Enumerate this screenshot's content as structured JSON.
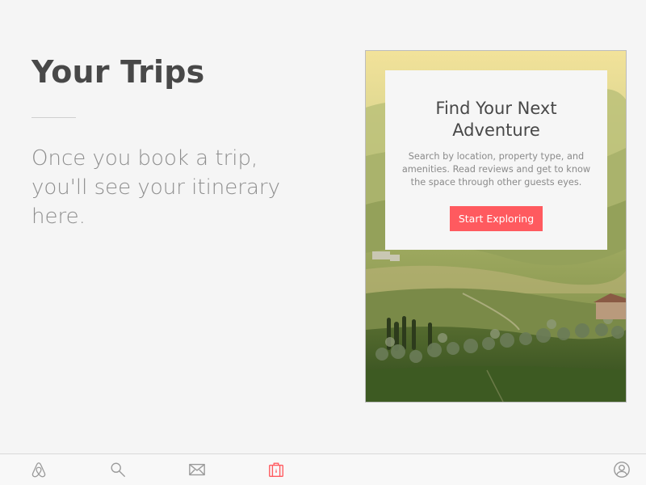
{
  "page": {
    "title": "Your Trips",
    "empty_message": "Once you book a trip, you'll see your itinerary here."
  },
  "promo_card": {
    "title": "Find Your Next Adventure",
    "body": "Search by location, property type, and amenities.  Read reviews and get to know the space through other guests eyes.",
    "button_label": "Start Exploring",
    "button_color": "#ff5a5f"
  },
  "tabbar": {
    "active_color": "#ff5a5f",
    "inactive_color": "#9a9a9a",
    "tabs": [
      {
        "icon": "airbnb-logo-icon",
        "active": false
      },
      {
        "icon": "search-icon",
        "active": false
      },
      {
        "icon": "mail-icon",
        "active": false
      },
      {
        "icon": "suitcase-icon",
        "active": true
      },
      {
        "icon": "profile-icon",
        "active": false
      }
    ]
  },
  "colors": {
    "background": "#f5f5f5",
    "title_text": "#484848",
    "muted_text": "#8e8e8e"
  }
}
